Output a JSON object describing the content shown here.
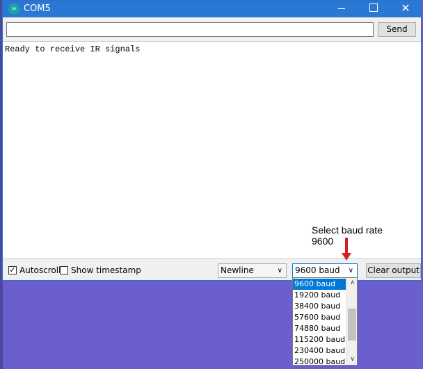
{
  "window": {
    "title": "COM5",
    "app_icon": "infinity-icon",
    "minimize_glyph": "",
    "close_glyph": "✕"
  },
  "send": {
    "input_value": "",
    "button_label": "Send"
  },
  "output": {
    "lines": [
      "Ready to receive IR signals"
    ]
  },
  "bottom": {
    "autoscroll_label": "Autoscroll",
    "autoscroll_checked": true,
    "timestamp_label": "Show timestamp",
    "timestamp_checked": false,
    "line_ending": "Newline",
    "baud_selected": "9600 baud",
    "clear_label": "Clear output"
  },
  "annotation": {
    "line1": "Select baud rate",
    "line2": "9600"
  },
  "baud_options": [
    "9600 baud",
    "19200 baud",
    "38400 baud",
    "57600 baud",
    "74880 baud",
    "115200 baud",
    "230400 baud",
    "250000 baud"
  ],
  "colors": {
    "titlebar": "#2b78d4",
    "selection": "#0078d7",
    "arrow": "#d32020",
    "desktop": "#6b5fd0"
  }
}
